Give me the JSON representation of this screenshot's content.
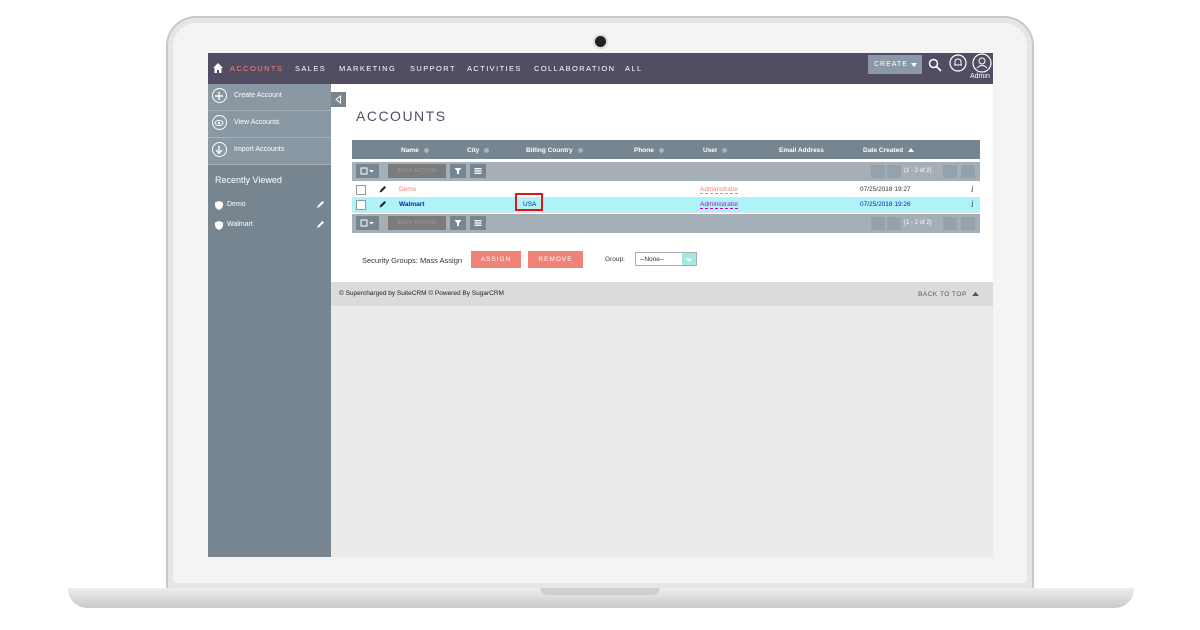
{
  "nav": {
    "items": [
      "ACCOUNTS",
      "SALES",
      "MARKETING",
      "SUPPORT",
      "ACTIVITIES",
      "COLLABORATION",
      "ALL"
    ],
    "create_label": "CREATE",
    "user_label": "Admin"
  },
  "sidebar": {
    "actions": [
      "Create Account",
      "View Accounts",
      "Import Accounts"
    ],
    "recent_title": "Recently Viewed",
    "recent_items": [
      "Demo",
      "Walmart"
    ]
  },
  "page": {
    "title": "ACCOUNTS"
  },
  "table": {
    "columns": [
      "Name",
      "City",
      "Billing Country",
      "Phone",
      "User",
      "Email Address",
      "Date Created"
    ],
    "bulk_action": "BULK ACTION",
    "pagination": "(1 - 2 of 2)",
    "rows": [
      {
        "name": "Demo",
        "city": "",
        "billing_country": "",
        "phone": "",
        "user": "Administrator",
        "email": "",
        "date_created": "07/25/2018 19:27"
      },
      {
        "name": "Walmart",
        "city": "",
        "billing_country": "USA",
        "phone": "",
        "user": "Administrator",
        "email": "",
        "date_created": "07/25/2018 19:26"
      }
    ]
  },
  "security": {
    "label": "Security Groups: Mass Assign",
    "assign": "ASSIGN",
    "remove": "REMOVE",
    "group_label": "Group:",
    "group_value": "--None--"
  },
  "footer": {
    "left": "© Supercharged by SuiteCRM   © Powered By SugarCRM",
    "back_to_top": "BACK TO TOP"
  },
  "colors": {
    "nav_bg": "#534d64",
    "accent": "#f08377",
    "sidebar_bg": "#778591",
    "selected_row": "#aef3f8",
    "highlight_box": "#e2141a"
  }
}
